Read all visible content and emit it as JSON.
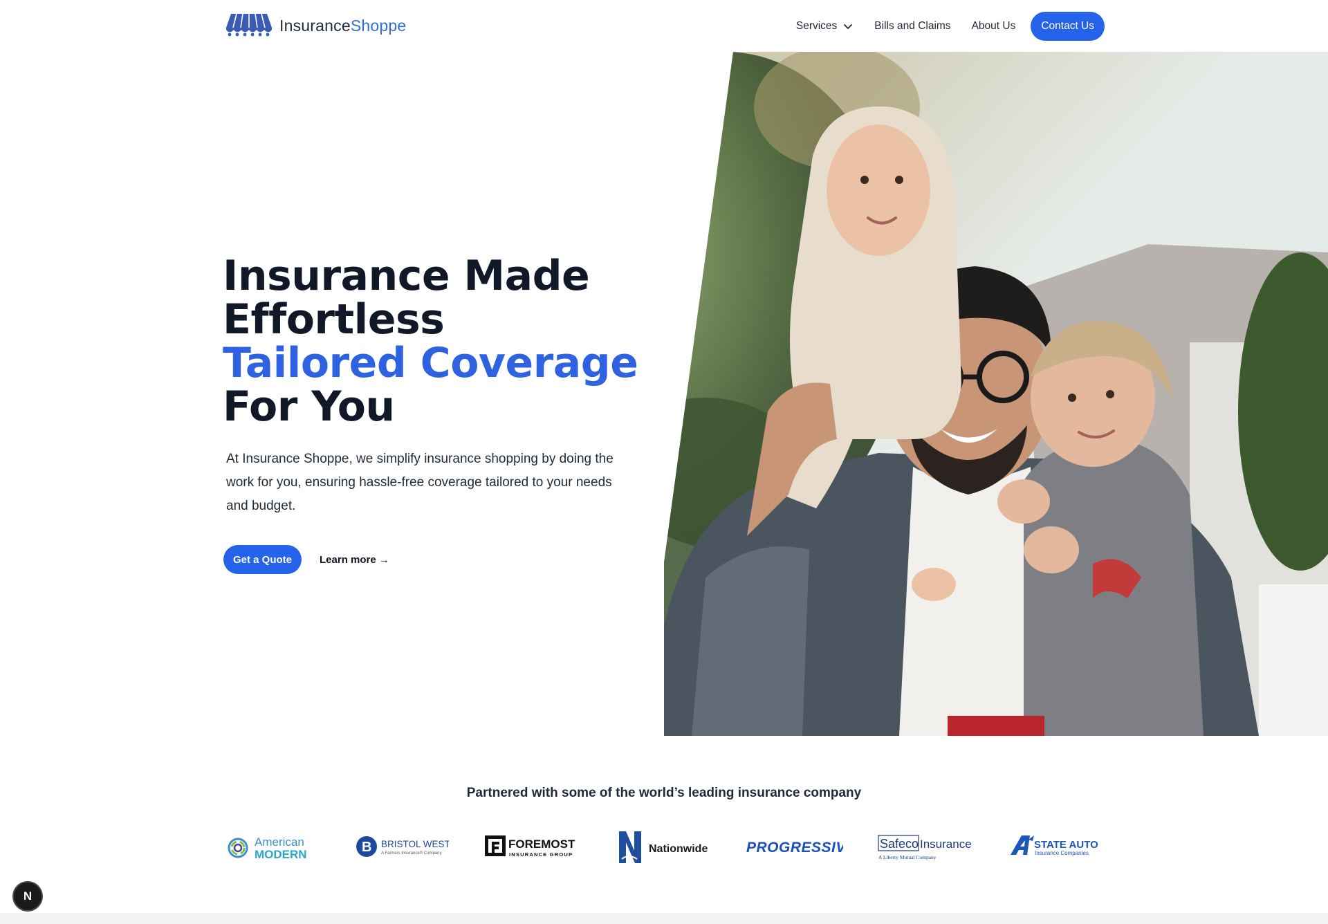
{
  "brand": {
    "name_part1": "Insurance",
    "name_part2": "Shoppe",
    "logo_icon": "awning-icon",
    "colors": {
      "primary": "#2563eb",
      "logo_blue": "#2f6fd6",
      "logo_mark": "#3b5bb4",
      "headline": "#111827"
    }
  },
  "nav": {
    "services": "Services",
    "bills": "Bills and Claims",
    "about": "About Us",
    "contact": "Contact Us"
  },
  "hero": {
    "line1": "Insurance Made",
    "line2": "Effortless",
    "line3": "Tailored Coverage",
    "line4": "For You",
    "description": "At Insurance Shoppe, we simplify insurance shopping by doing the work for you, ensuring hassle-free coverage tailored to your needs and budget.",
    "cta_primary": "Get a Quote",
    "cta_secondary": "Learn more →"
  },
  "partners": {
    "title": "Partnered with some of the world’s leading insurance company",
    "american_modern": {
      "line1": "American",
      "line2": "MODERN"
    },
    "bristol_west": {
      "name": "BRISTOL WEST",
      "tagline": "A Farmers Insurance® Company"
    },
    "foremost": {
      "name": "FOREMOST",
      "tagline": "INSURANCE GROUP"
    },
    "nationwide": {
      "name": "Nationwide"
    },
    "progressive": {
      "name": "PROGRESSIVE"
    },
    "safeco": {
      "name1": "Safeco",
      "name2": "Insurance",
      "tagline": "A Liberty Mutual Company"
    },
    "state_auto": {
      "name": "STATE AUTO",
      "tagline": "Insurance Companies"
    }
  },
  "dev_badge": "N"
}
